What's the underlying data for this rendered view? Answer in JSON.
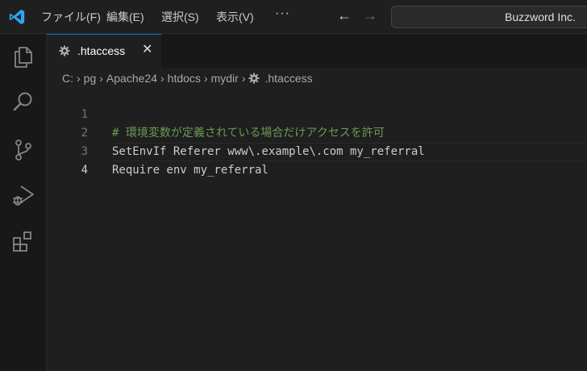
{
  "menu": {
    "file": "ファイル(F)",
    "edit": "編集(E)",
    "selection": "選択(S)",
    "view": "表示(V)",
    "more": "···"
  },
  "search": {
    "text": "Buzzword Inc."
  },
  "activity_bar": {
    "icons": [
      "explorer-icon",
      "search-icon",
      "source-control-icon",
      "run-debug-icon",
      "extensions-icon"
    ]
  },
  "tab": {
    "label": ".htaccess",
    "close": "✕",
    "icon": "gear-icon"
  },
  "breadcrumb": [
    "C:",
    "pg",
    "Apache24",
    "htdocs",
    "mydir",
    ".htaccess"
  ],
  "editor": {
    "lines": [
      {
        "number": "1",
        "text": "# 環境変数が定義されている場合だけアクセスを許可",
        "kind": "comment"
      },
      {
        "number": "2",
        "text": "SetEnvIf Referer www\\.example\\.com my_referral",
        "kind": "code"
      },
      {
        "number": "3",
        "text": "Require env my_referral",
        "kind": "code"
      },
      {
        "number": "4",
        "text": "",
        "kind": "code"
      }
    ]
  },
  "colors": {
    "accent": "#0078d4",
    "comment": "#6a9955",
    "text": "#cccccc",
    "editor_bg": "#1f1f1f"
  }
}
